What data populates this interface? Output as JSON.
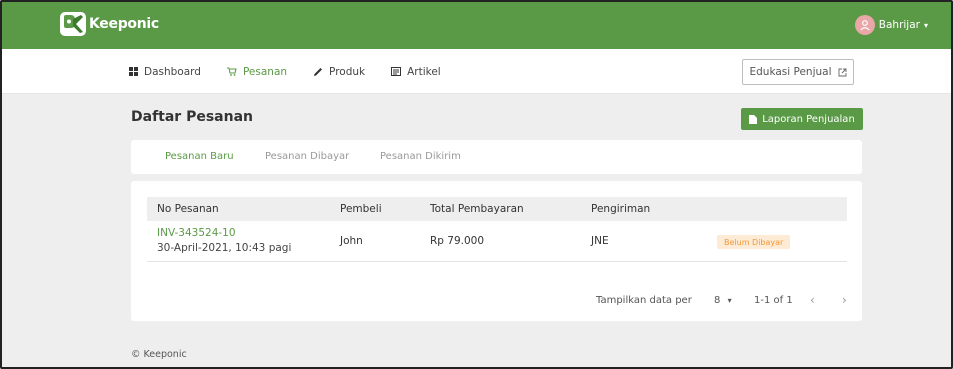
{
  "app": {
    "logo_text": "Keeponic",
    "brand_color": "#5a9a46"
  },
  "user": {
    "name": "Bahrijar",
    "avatar_icon": "user-avatar-icon"
  },
  "nav": {
    "items": [
      {
        "label": "Dashboard",
        "icon": "grid-icon",
        "active": false
      },
      {
        "label": "Pesanan",
        "icon": "cart-icon",
        "active": true
      },
      {
        "label": "Produk",
        "icon": "pencil-icon",
        "active": false
      },
      {
        "label": "Artikel",
        "icon": "article-icon",
        "active": false
      }
    ],
    "edukasi_label": "Edukasi Penjual"
  },
  "page": {
    "title": "Daftar Pesanan",
    "report_button": "Laporan Penjualan"
  },
  "tabs": [
    {
      "label": "Pesanan Baru",
      "active": true
    },
    {
      "label": "Pesanan Dibayar",
      "active": false
    },
    {
      "label": "Pesanan Dikirim",
      "active": false
    }
  ],
  "table": {
    "headers": [
      "No Pesanan",
      "Pembeli",
      "Total Pembayaran",
      "Pengiriman"
    ],
    "rows": [
      {
        "invoice": "INV-343524-10",
        "datetime": "30-April-2021, 10:43 pagi",
        "buyer": "John",
        "total": "Rp 79.000",
        "shipping": "JNE",
        "status": "Belum Dibayar"
      }
    ]
  },
  "pagination": {
    "label": "Tampilkan data per",
    "per_page": "8",
    "range": "1-1 of 1"
  },
  "footer": {
    "text": "© Keeponic"
  }
}
